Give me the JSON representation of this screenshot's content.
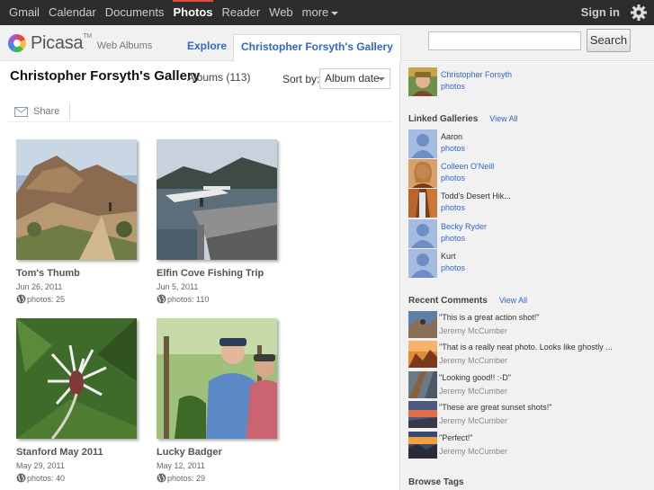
{
  "gbar": {
    "nav": [
      "Gmail",
      "Calendar",
      "Documents",
      "Photos",
      "Reader",
      "Web",
      "more"
    ],
    "active_index": 3,
    "signin": "Sign in"
  },
  "header": {
    "logo_word": "Picasa",
    "logo_tm": "TM",
    "logo_sub": "Web Albums",
    "tab_explore": "Explore",
    "tab_gallery": "Christopher Forsyth's Gallery",
    "search_value": "",
    "search_button": "Search"
  },
  "main": {
    "title": "Christopher Forsyth's Gallery",
    "albums_label": "Albums (113)",
    "sort_label": "Sort by:",
    "sort_value": "Album date",
    "share_label": "Share",
    "albums": [
      {
        "name": "Tom's Thumb",
        "date": "Jun 26, 2011",
        "photos": "photos: 25"
      },
      {
        "name": "Elfin Cove Fishing Trip",
        "date": "Jun 5, 2011",
        "photos": "photos: 110"
      },
      {
        "name": "Stanford May 2011",
        "date": "May 29, 2011",
        "photos": "photos: 40"
      },
      {
        "name": "Lucky Badger",
        "date": "May 12, 2011",
        "photos": "photos: 29"
      }
    ]
  },
  "sidebar": {
    "owner": {
      "name": "Christopher Forsyth",
      "photos": "photos"
    },
    "linked_title": "Linked Galleries",
    "view_all": "View All",
    "linked": [
      {
        "name": "Aaron",
        "photos": "photos"
      },
      {
        "name": "Colleen O'Neill",
        "photos": "photos"
      },
      {
        "name": "Todd's Desert Hik...",
        "photos": "photos"
      },
      {
        "name": "Becky Ryder",
        "photos": "photos"
      },
      {
        "name": "Kurt",
        "photos": "photos"
      }
    ],
    "comments_title": "Recent Comments",
    "comments": [
      {
        "text": "\"This is a great action shot!\"",
        "author": "Jeremy McCumber"
      },
      {
        "text": "\"That is a really neat photo. Looks like ghostly ...",
        "author": "Jeremy McCumber"
      },
      {
        "text": "\"Looking good!! :-D\"",
        "author": "Jeremy McCumber"
      },
      {
        "text": "\"These are great sunset shots!\"",
        "author": "Jeremy McCumber"
      },
      {
        "text": "\"Perfect!\"",
        "author": "Jeremy McCumber"
      }
    ],
    "tags_title": "Browse Tags"
  }
}
